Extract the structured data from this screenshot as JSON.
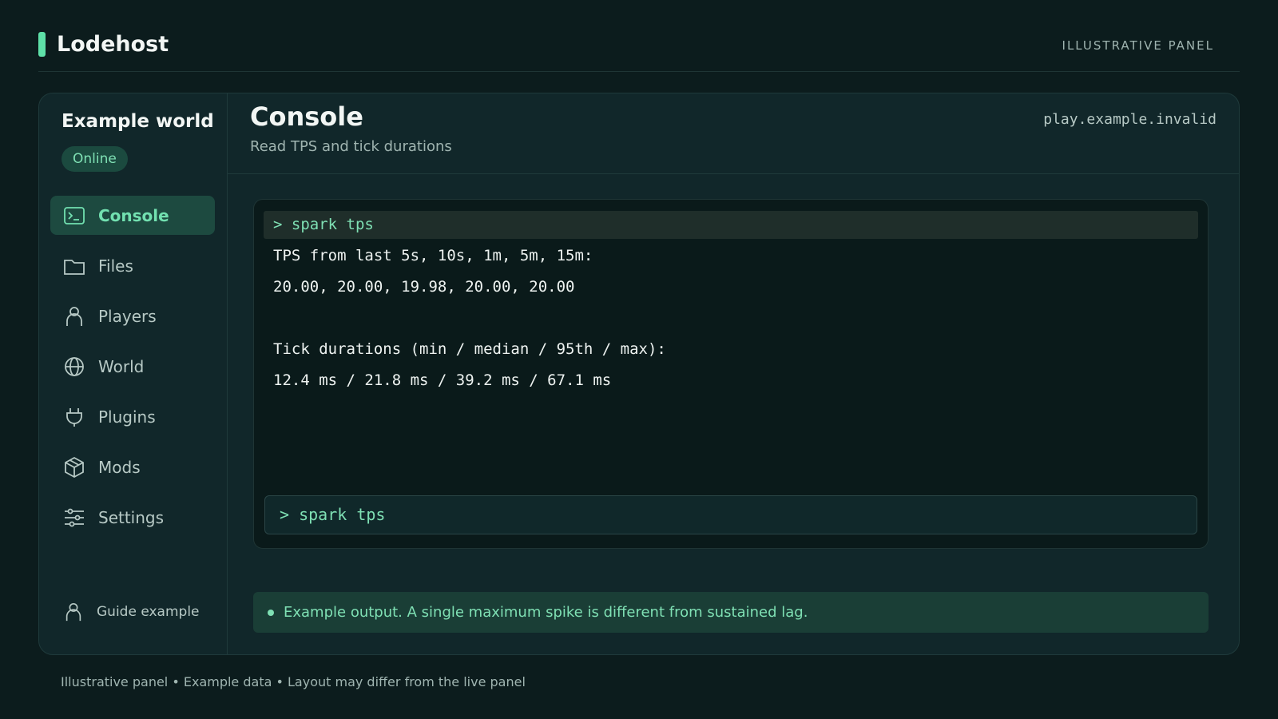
{
  "brand": {
    "name": "Lodehost",
    "top_label": "ILLUSTRATIVE PANEL"
  },
  "server": {
    "name": "Example world",
    "status": "Online",
    "host": "play.example.invalid"
  },
  "sidebar": {
    "items": [
      {
        "label": "Console",
        "icon": "terminal-icon",
        "active": true
      },
      {
        "label": "Files",
        "icon": "folder-icon"
      },
      {
        "label": "Players",
        "icon": "user-icon"
      },
      {
        "label": "World",
        "icon": "globe-icon"
      },
      {
        "label": "Plugins",
        "icon": "plug-icon"
      },
      {
        "label": "Mods",
        "icon": "box-icon"
      },
      {
        "label": "Settings",
        "icon": "sliders-icon"
      }
    ],
    "guide_label": "Guide example"
  },
  "main": {
    "title": "Console",
    "subtitle": "Read TPS and tick durations"
  },
  "console": {
    "command": "> spark tps",
    "lines": [
      "TPS from last 5s, 10s, 1m, 5m, 15m:",
      "20.00, 20.00, 19.98, 20.00, 20.00",
      "",
      "Tick durations (min / median / 95th / max):",
      "12.4 ms / 21.8 ms / 39.2 ms / 67.1 ms"
    ],
    "input_value": "> spark tps"
  },
  "note": "Example output. A single maximum spike is different from sustained lag.",
  "footer": "Illustrative panel • Example data • Layout may differ from the live panel",
  "colors": {
    "accent": "#5ee0a8",
    "background": "#0c1c1d",
    "panel": "#11272a"
  }
}
